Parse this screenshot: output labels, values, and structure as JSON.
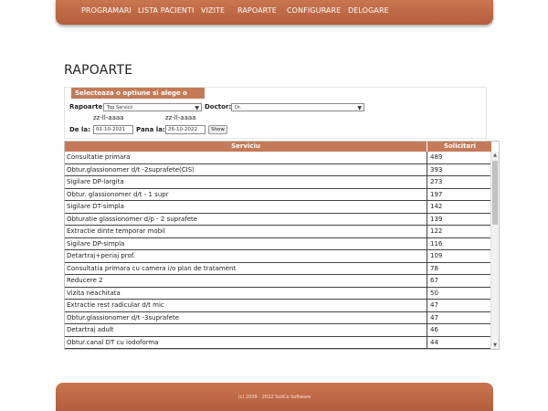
{
  "nav": {
    "items": [
      "PROGRAMARI",
      "LISTA PACIENTI",
      "VIZITE",
      "RAPOARTE",
      "CONFIGURARE",
      "DELOGARE"
    ]
  },
  "page": {
    "title": "RAPOARTE"
  },
  "filters": {
    "header": "Selecteaza o optiune si alege o perioada",
    "rapoarte_label": "Rapoarte:",
    "rapoarte_value": "Top Servicii",
    "doctor_label": "Doctor:",
    "doctor_value": "Dr. ",
    "date_hint": "zz-ll-aaaa",
    "from_label": "De la:",
    "from_value": "01-10-2021",
    "to_label": "Pana la:",
    "to_value": "26-10-2022",
    "show_button": "Show"
  },
  "table": {
    "headers": [
      "Serviciu",
      "Solicitari"
    ],
    "rows": [
      [
        "Consultatie primara",
        "489"
      ],
      [
        "Obtur.glassionomer d/t -2suprafete(CIS)",
        "393"
      ],
      [
        "Sigilare DP-largita",
        "273"
      ],
      [
        "Obtur. glassionomer d/t - 1 supr",
        "197"
      ],
      [
        "Sigilare DT-simpla",
        "142"
      ],
      [
        "Obturatie glassionomer d/p - 2 suprafete",
        "139"
      ],
      [
        "Extractie dinte temporar mobil",
        "122"
      ],
      [
        "Sigilare DP-simpla",
        "116"
      ],
      [
        "Detartraj+periaj prof.",
        "109"
      ],
      [
        "Consultatia primara cu camera i/o plan de tratament",
        "78"
      ],
      [
        "Reducere 2",
        "67"
      ],
      [
        "Vizita neachitata",
        "50"
      ],
      [
        "Extractie rest radicular d/t mic",
        "47"
      ],
      [
        "Obtur.glassionomer d/t -3suprafete",
        "47"
      ],
      [
        "Detartraj adult",
        "46"
      ],
      [
        "Obtur.canal DT cu iodoforma",
        "44"
      ]
    ]
  },
  "footer": {
    "text": "(c) 2009 - 2022 SoliCo Software"
  },
  "colors": {
    "accent": "#c47a58",
    "bar": "#bf6a48"
  }
}
